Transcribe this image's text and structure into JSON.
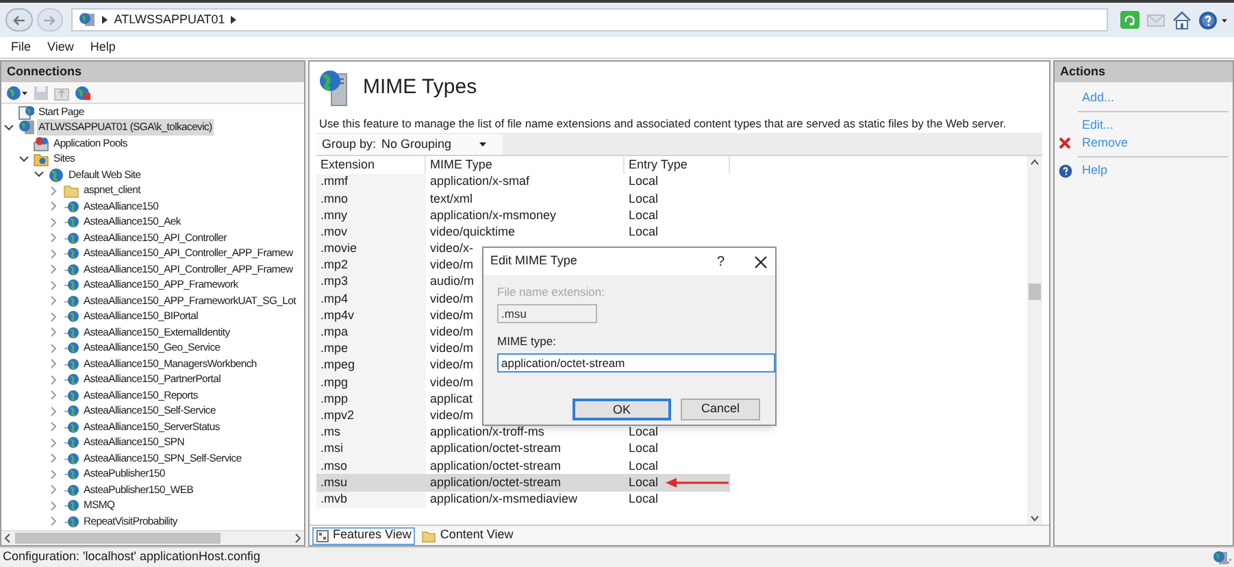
{
  "address_bar": {
    "path": [
      "ATLWSSAPPUAT01"
    ]
  },
  "menu": [
    "File",
    "View",
    "Help"
  ],
  "connections": {
    "title": "Connections",
    "tree": [
      {
        "label": "Start Page",
        "kind": "start",
        "selected": false
      },
      {
        "label": "ATLWSSAPPUAT01 (SGA\\k_tolkacevic)",
        "kind": "server",
        "selected": true,
        "expanded": true,
        "children": [
          {
            "label": "Application Pools",
            "kind": "pools",
            "selected": false
          },
          {
            "label": "Sites",
            "kind": "sites",
            "selected": false,
            "expanded": true,
            "children": [
              {
                "label": "Default Web Site",
                "kind": "website",
                "selected": false,
                "expanded": true,
                "children": [
                  {
                    "label": "aspnet_client",
                    "kind": "folder",
                    "selected": false,
                    "expanded": false
                  },
                  {
                    "label": "AsteaAlliance150",
                    "kind": "app",
                    "selected": false,
                    "expanded": false
                  },
                  {
                    "label": "AsteaAlliance150_Aek",
                    "kind": "app",
                    "selected": false,
                    "expanded": false
                  },
                  {
                    "label": "AsteaAlliance150_API_Controller",
                    "kind": "app",
                    "selected": false,
                    "expanded": false
                  },
                  {
                    "label": "AsteaAlliance150_API_Controller_APP_Framew",
                    "kind": "app",
                    "selected": false,
                    "expanded": false
                  },
                  {
                    "label": "AsteaAlliance150_API_Controller_APP_Framew",
                    "kind": "app",
                    "selected": false,
                    "expanded": false
                  },
                  {
                    "label": "AsteaAlliance150_APP_Framework",
                    "kind": "app",
                    "selected": false,
                    "expanded": false
                  },
                  {
                    "label": "AsteaAlliance150_APP_FrameworkUAT_SG_Lot",
                    "kind": "app",
                    "selected": false,
                    "expanded": false
                  },
                  {
                    "label": "AsteaAlliance150_BIPortal",
                    "kind": "app",
                    "selected": false,
                    "expanded": false
                  },
                  {
                    "label": "AsteaAlliance150_ExternalIdentity",
                    "kind": "app",
                    "selected": false,
                    "expanded": false
                  },
                  {
                    "label": "AsteaAlliance150_Geo_Service",
                    "kind": "app",
                    "selected": false,
                    "expanded": false
                  },
                  {
                    "label": "AsteaAlliance150_ManagersWorkbench",
                    "kind": "app",
                    "selected": false,
                    "expanded": false
                  },
                  {
                    "label": "AsteaAlliance150_PartnerPortal",
                    "kind": "app",
                    "selected": false,
                    "expanded": false
                  },
                  {
                    "label": "AsteaAlliance150_Reports",
                    "kind": "app",
                    "selected": false,
                    "expanded": false
                  },
                  {
                    "label": "AsteaAlliance150_Self-Service",
                    "kind": "app",
                    "selected": false,
                    "expanded": false
                  },
                  {
                    "label": "AsteaAlliance150_ServerStatus",
                    "kind": "app",
                    "selected": false,
                    "expanded": false
                  },
                  {
                    "label": "AsteaAlliance150_SPN",
                    "kind": "app",
                    "selected": false,
                    "expanded": false
                  },
                  {
                    "label": "AsteaAlliance150_SPN_Self-Service",
                    "kind": "app",
                    "selected": false,
                    "expanded": false
                  },
                  {
                    "label": "AsteaPublisher150",
                    "kind": "app",
                    "selected": false,
                    "expanded": false
                  },
                  {
                    "label": "AsteaPublisher150_WEB",
                    "kind": "app",
                    "selected": false,
                    "expanded": false
                  },
                  {
                    "label": "MSMQ",
                    "kind": "app",
                    "selected": false,
                    "expanded": false
                  },
                  {
                    "label": "RepeatVisitProbability",
                    "kind": "app",
                    "selected": false,
                    "expanded": false
                  }
                ]
              }
            ]
          }
        ]
      }
    ]
  },
  "feature": {
    "title": "MIME Types",
    "description": "Use this feature to manage the list of file name extensions and associated content types that are served as static files by the Web server.",
    "group_by": {
      "label": "Group by:",
      "value": "No Grouping"
    },
    "columns": [
      "Extension",
      "MIME Type",
      "Entry Type"
    ],
    "rows": [
      {
        "extension": ".mmf",
        "mime_type": "application/x-smaf",
        "entry_type": "Local",
        "selected": false
      },
      {
        "extension": ".mno",
        "mime_type": "text/xml",
        "entry_type": "Local",
        "selected": false
      },
      {
        "extension": ".mny",
        "mime_type": "application/x-msmoney",
        "entry_type": "Local",
        "selected": false
      },
      {
        "extension": ".mov",
        "mime_type": "video/quicktime",
        "entry_type": "Local",
        "selected": false
      },
      {
        "extension": ".movie",
        "mime_type": "video/x-",
        "selected": false
      },
      {
        "extension": ".mp2",
        "mime_type": "video/m",
        "selected": false
      },
      {
        "extension": ".mp3",
        "mime_type": "audio/m",
        "selected": false
      },
      {
        "extension": ".mp4",
        "mime_type": "video/m",
        "selected": false
      },
      {
        "extension": ".mp4v",
        "mime_type": "video/m",
        "selected": false
      },
      {
        "extension": ".mpa",
        "mime_type": "video/m",
        "selected": false
      },
      {
        "extension": ".mpe",
        "mime_type": "video/m",
        "selected": false
      },
      {
        "extension": ".mpeg",
        "mime_type": "video/m",
        "selected": false
      },
      {
        "extension": ".mpg",
        "mime_type": "video/m",
        "selected": false
      },
      {
        "extension": ".mpp",
        "mime_type": "applicat",
        "selected": false
      },
      {
        "extension": ".mpv2",
        "mime_type": "video/m",
        "selected": false
      },
      {
        "extension": ".ms",
        "mime_type": "application/x-troff-ms",
        "entry_type": "Local",
        "selected": false
      },
      {
        "extension": ".msi",
        "mime_type": "application/octet-stream",
        "entry_type": "Local",
        "selected": false
      },
      {
        "extension": ".mso",
        "mime_type": "application/octet-stream",
        "entry_type": "Local",
        "selected": false
      },
      {
        "extension": ".msu",
        "mime_type": "application/octet-stream",
        "entry_type": "Local",
        "selected": true
      },
      {
        "extension": ".mvb",
        "mime_type": "application/x-msmediaview",
        "entry_type": "Local",
        "selected": false
      }
    ]
  },
  "view_tabs": [
    {
      "label": "Features View",
      "selected": true
    },
    {
      "label": "Content View",
      "selected": false
    }
  ],
  "actions": {
    "title": "Actions",
    "groups": [
      [
        {
          "label": "Add...",
          "kind": "plain"
        }
      ],
      [
        {
          "label": "Edit...",
          "kind": "plain"
        },
        {
          "label": "Remove",
          "kind": "delete"
        }
      ],
      [
        {
          "label": "Help",
          "kind": "help"
        }
      ]
    ]
  },
  "dialog": {
    "title": "Edit MIME Type",
    "help": "?",
    "fields": [
      {
        "label": "File name extension:",
        "value": ".msu",
        "disabled": true
      },
      {
        "label": "MIME type:",
        "value": "application/octet-stream",
        "disabled": false
      }
    ],
    "buttons": [
      {
        "label": "OK",
        "default": true
      },
      {
        "label": "Cancel",
        "default": false
      }
    ]
  },
  "status_bar": "Configuration: 'localhost' applicationHost.config"
}
